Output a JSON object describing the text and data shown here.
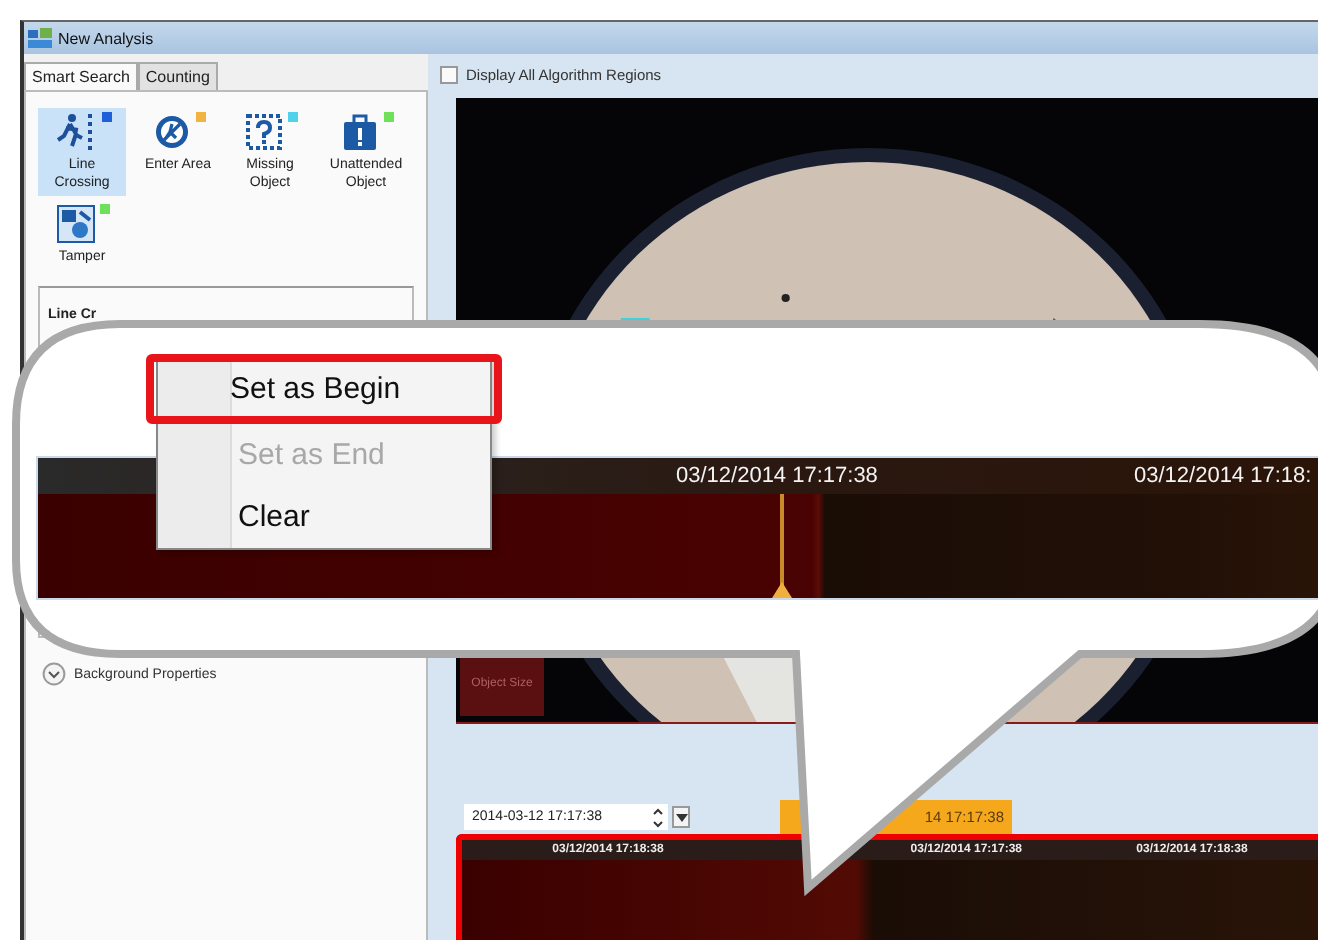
{
  "window": {
    "title": "New Analysis"
  },
  "tabs": [
    {
      "label": "Smart Search",
      "selected": true
    },
    {
      "label": "Counting",
      "selected": false
    }
  ],
  "algorithms": [
    {
      "label": "Line Crossing",
      "selected": true,
      "color": "#1f5fd8",
      "kind": "line"
    },
    {
      "label": "Enter Area",
      "selected": false,
      "color": "#f2b441",
      "kind": "area"
    },
    {
      "label": "Missing Object",
      "selected": false,
      "color": "#4fd2ea",
      "kind": "missing"
    },
    {
      "label": "Unattended Object",
      "selected": false,
      "color": "#6de15a",
      "kind": "unattended"
    },
    {
      "label": "Tamper",
      "selected": false,
      "color": "#6de15a",
      "kind": "tamper"
    }
  ],
  "group_header": "Line Cr",
  "background_properties": {
    "label": "Background Properties"
  },
  "display_all_regions": {
    "label": "Display All Algorithm Regions",
    "checked": false
  },
  "object_size_button": "Object Size",
  "date_field": {
    "value": "2014-03-12 17:17:38"
  },
  "time_tag": "14 17:17:38",
  "timeline": {
    "labels": [
      "03/12/2014 17:18:38",
      "03/12/2014 17:17:38",
      "03/12/2014 17:18:38"
    ]
  },
  "callout": {
    "menu": [
      {
        "label": "Set as Begin",
        "disabled": false,
        "highlighted": true
      },
      {
        "label": "Set as End",
        "disabled": true,
        "highlighted": false
      },
      {
        "label": "Clear",
        "disabled": false,
        "highlighted": false
      }
    ],
    "timeline_labels": [
      "03/12/2014 17:17:38",
      "03/12/2014 17:18:"
    ]
  }
}
